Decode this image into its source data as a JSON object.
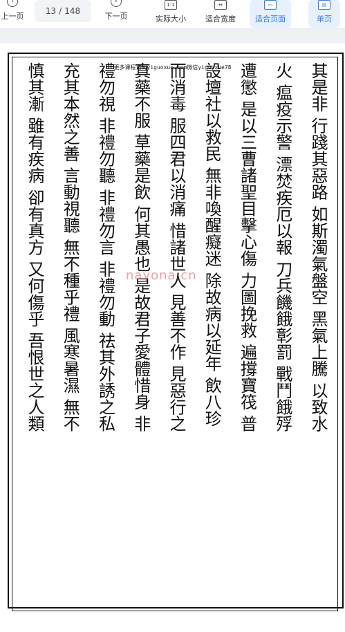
{
  "toolbar": {
    "prev_icon": "‹",
    "prev_label": "上一页",
    "page_current": "13",
    "page_sep": "/",
    "page_total": "148",
    "next_icon": "›",
    "next_label": "下一页",
    "actual_size_icon": "1:1",
    "actual_size_label": "实际大小",
    "fit_width_icon": "↔",
    "fit_width_label": "适合宽度",
    "fit_page_icon": "▭",
    "fit_page_label": "适合页面",
    "single_icon": "▤",
    "single_label": "单页"
  },
  "page": {
    "header": "更多课程访问yiguoxue.com微信yiguoxue78",
    "watermark": "nayona.cn",
    "columns": [
      "其是非 行踐其惡路 如斯濁氣盤空 黑氣上騰 以致水",
      "火 瘟疫示警 漂焚疾厄以報 刀兵饑餓彰罰 戰鬥餓殍",
      "遭懲 是以三曹諸聖目擊心傷 力圖挽救 遍撐寶筏 普",
      "設壇社以救民 無非喚醒癡迷 除故病以延年 飲八珍",
      "而消毒 服四君以消痛 惜諸世人 見善不作 見惡行之",
      "真藥不服 草藥是飲 何其愚也 是故君子愛體惜身 非",
      "禮勿視 非禮勿聽 非禮勿言 非禮勿動 祛其外誘之私",
      "充其本然之善 言動視聽 無不種乎禮 風寒暑濕 無不",
      "慎其漸 雖有疾病 卻有真方 又何傷乎 吾恨世之人類"
    ]
  },
  "colors": {
    "accent": "#2f7bf6",
    "background": "#f3f4f6"
  }
}
